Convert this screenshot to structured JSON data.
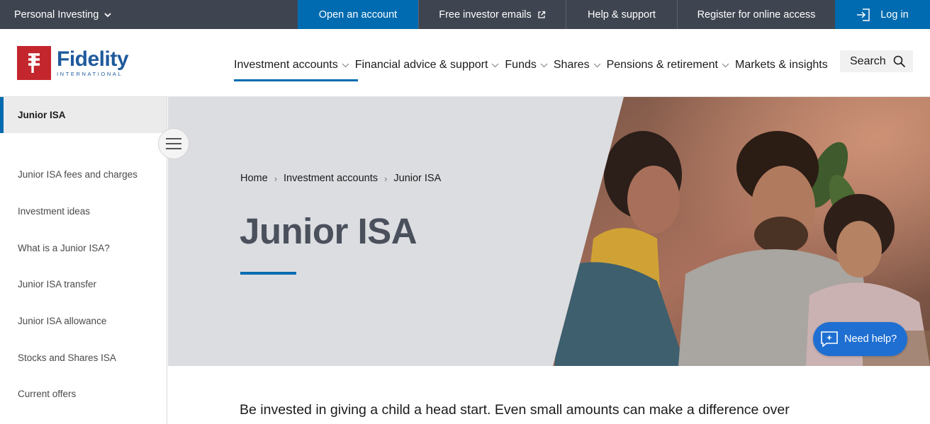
{
  "topbar": {
    "personal": "Personal Investing",
    "open_account": "Open an account",
    "emails": "Free investor emails",
    "help": "Help & support",
    "register": "Register for online access",
    "login": "Log in"
  },
  "logo": {
    "name": "Fidelity",
    "sub": "INTERNATIONAL"
  },
  "nav": {
    "items": [
      {
        "label": "Investment accounts"
      },
      {
        "label": "Financial advice & support"
      },
      {
        "label": "Funds"
      },
      {
        "label": "Shares"
      },
      {
        "label": "Pensions & retirement"
      },
      {
        "label": "Markets & insights"
      }
    ],
    "search": "Search"
  },
  "sidebar": {
    "active": "Junior ISA",
    "items": [
      {
        "label": "Junior ISA fees and charges"
      },
      {
        "label": "Investment ideas"
      },
      {
        "label": "What is a Junior ISA?"
      },
      {
        "label": "Junior ISA transfer"
      },
      {
        "label": "Junior ISA allowance"
      },
      {
        "label": "Stocks and Shares ISA"
      },
      {
        "label": "Current offers"
      }
    ]
  },
  "hero": {
    "breadcrumb": [
      "Home",
      "Investment accounts",
      "Junior ISA"
    ],
    "title": "Junior ISA"
  },
  "chat": {
    "label": "Need help?"
  },
  "intro": "Be invested in giving a child a head start. Even small amounts can make a difference over",
  "colors": {
    "brand_blue": "#006bb0",
    "brand_red": "#c4262e",
    "topbar": "#3f4550"
  }
}
